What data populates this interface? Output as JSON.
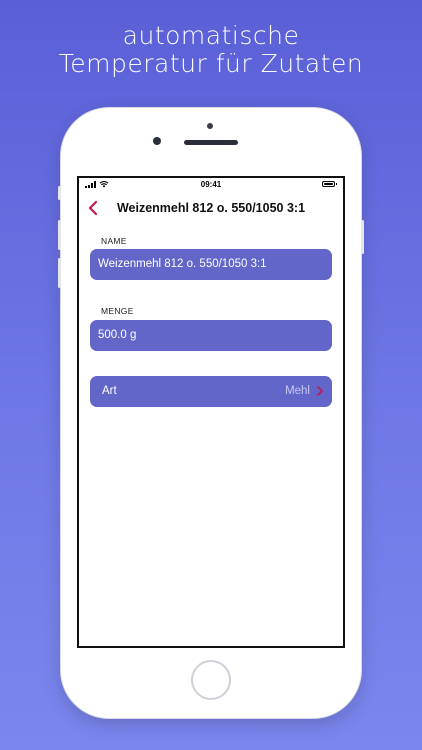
{
  "headline": {
    "line1": "automatische",
    "line2": "Temperatur für Zutaten"
  },
  "status_bar": {
    "time": "09:41"
  },
  "nav": {
    "title": "Weizenmehl 812 o. 550/1050 3:1",
    "back_icon": "chevron-left-icon"
  },
  "form": {
    "name_label": "NAME",
    "name_value": "Weizenmehl 812 o. 550/1050 3:1",
    "amount_label": "MENGE",
    "amount_value": "500.0 g",
    "type_label": "Art",
    "type_value": "Mehl"
  },
  "colors": {
    "background_top": "#5a5fd6",
    "field_fill": "#6166c8",
    "accent": "#c2185b"
  }
}
